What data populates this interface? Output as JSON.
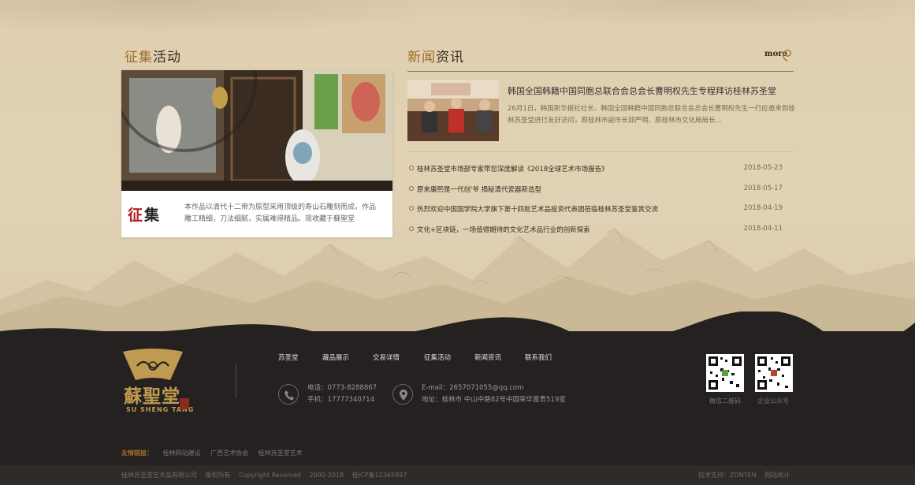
{
  "collect": {
    "title_a": "征集",
    "title_b": "活动",
    "stamp_a": "征",
    "stamp_b": "集",
    "description": "本作品以清代十二帝为原型采用顶级的寿山石雕刻而成，作品雕工精细，刀法细腻，实属难得精品。现收藏于蘇聖堂"
  },
  "news": {
    "title_a": "新闻",
    "title_b": "资讯",
    "more_label": "more",
    "featured": {
      "headline": "韩国全国韩籍中国同胞总联合会总会长曹明权先生专程拜访桂林苏圣堂",
      "summary": "26月1日，韩国新华报社社长、韩国全国韩籍中国同胞总联合会总会长曹明权先生一行应邀来到桂林苏圣堂进行友好访问，原桂林市副市长邱严明、原桂林市文化局局长..."
    },
    "items": [
      {
        "title": "桂林苏圣堂市场部专家带您深度解读《2018全球艺术市场报告》",
        "date": "2018-05-23"
      },
      {
        "title": "原来康熙是一代创'爷 揭秘清代瓷器新造型",
        "date": "2018-05-17"
      },
      {
        "title": "热烈欢迎中国国学院大学旗下第十四批艺术品投资代表团莅临桂林苏圣堂鉴赏交流",
        "date": "2018-04-19"
      },
      {
        "title": "文化+区块链，一场值得期待的文化艺术品行业的创新探索",
        "date": "2018-04-11"
      }
    ]
  },
  "footer": {
    "logo_text": "蘇聖堂",
    "logo_en": "SU SHENG TANG",
    "nav": [
      "苏圣堂",
      "藏品展示",
      "交易详情",
      "征集活动",
      "新闻资讯",
      "联系我们"
    ],
    "phone": "电话：0773-8288867",
    "mobile": "手机：17777340714",
    "email": "E-mail：2657071055@qq.com",
    "address": "地址：桂林市 中山中路82号中国荣华富贵519室",
    "qr_labels": [
      "微信二维码",
      "企业公众号"
    ],
    "links_label": "友情链接：",
    "links": [
      "桂林网站建设",
      "广西艺术协会",
      "桂林苏圣堂艺术"
    ],
    "copyright": [
      "桂林苏圣堂艺术品有限公司",
      "版权所有",
      "Copyright Reserved",
      "2000-2018",
      "桂ICP备12365897"
    ],
    "support": [
      "技术支持：ZONTEN",
      "网站统计"
    ]
  },
  "colors": {
    "accent": "#a06b2a",
    "paper": "#e1d2b5",
    "footer_bg": "#242120"
  }
}
